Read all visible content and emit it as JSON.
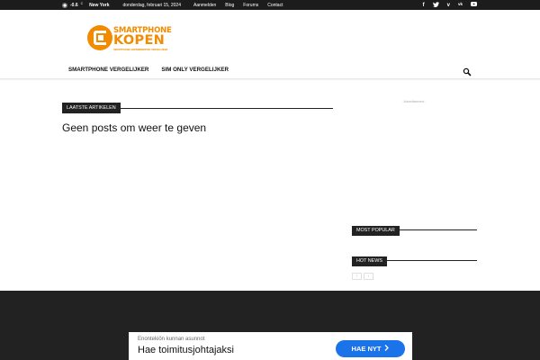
{
  "topbar": {
    "temperature": "-0.6",
    "unit": "C",
    "city": "New York",
    "date": "donderdag, februari 15, 2024",
    "links": [
      "Aanmelden",
      "Blog",
      "Forums",
      "Contact"
    ],
    "social": [
      "f",
      "t",
      "v",
      "vk",
      "yt"
    ]
  },
  "logo": {
    "line1": "SMARTPHONE",
    "line2": "KOPEN",
    "tagline": "SMARTPHONE ABONNEMENTEN VERGELIJKEN"
  },
  "nav": {
    "items": [
      "SMARTPHONE VERGELIJKER",
      "SIM ONLY VERGELIJKER"
    ]
  },
  "main": {
    "block_title": "LAATSTE ARTIKELEN",
    "empty_message": "Geen posts om weer te geven"
  },
  "sidebar": {
    "ad_label": "- Advertisement -",
    "most_popular": "MOST POPULAR",
    "hot_news": "HOT NEWS",
    "prev": "‹",
    "next": "›"
  },
  "ad": {
    "advertiser": "Enontekiön kunnan asunnot",
    "headline": "Hae toimitusjohtajaksi",
    "cta": "HAE NYT",
    "cta_icon": "chevron-right-icon"
  },
  "colors": {
    "brand": "#f28b00",
    "dark": "#222222",
    "cta": "#1a73e8"
  }
}
